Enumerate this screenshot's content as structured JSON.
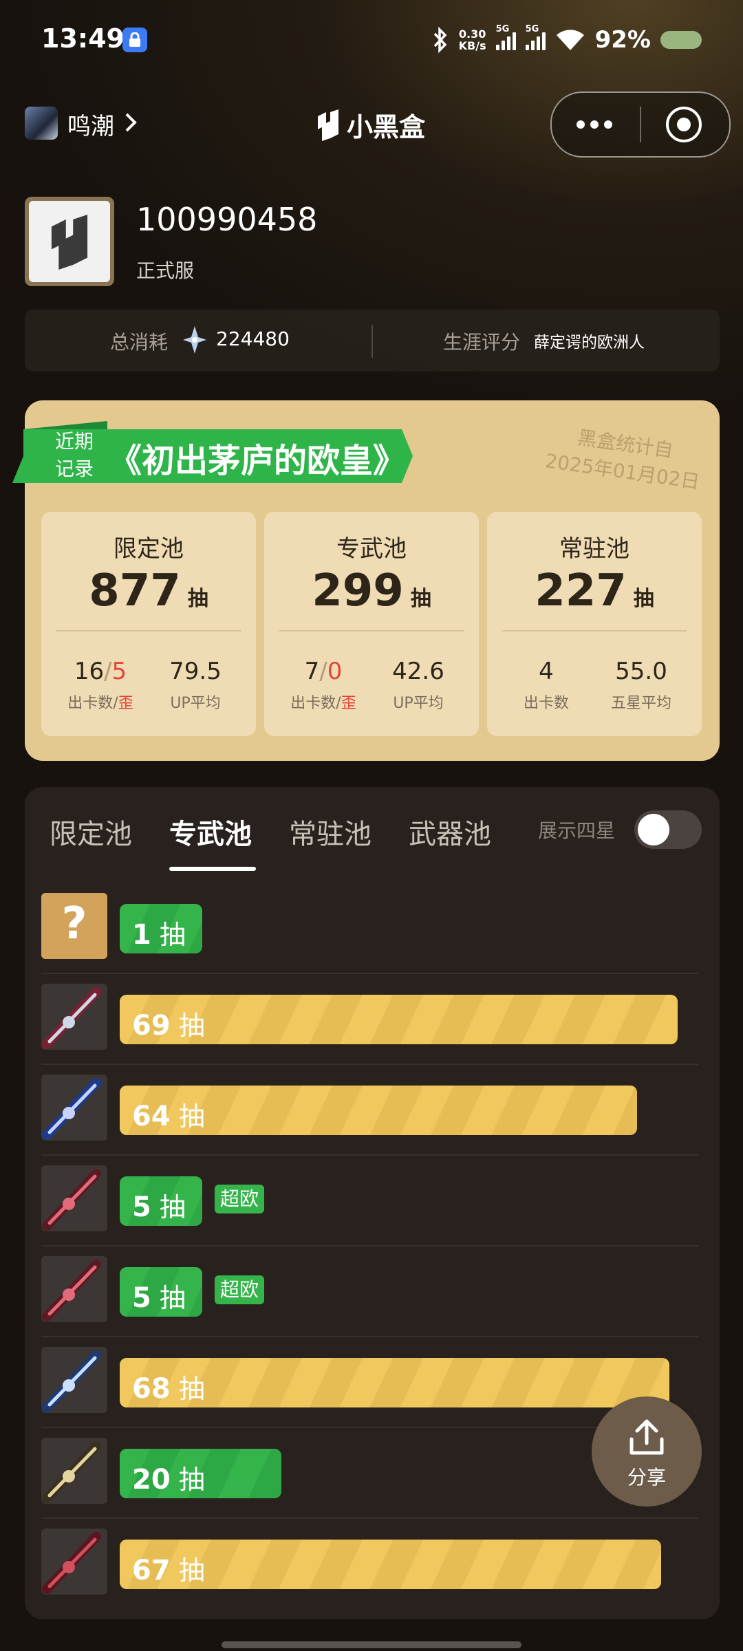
{
  "status_bar": {
    "time": "13:49",
    "net_speed_value": "0.30",
    "net_speed_unit": "KB/s",
    "sim1_label": "5G",
    "sim2_label": "5G",
    "battery": "92%",
    "icons": [
      "lock-icon",
      "bluetooth-icon",
      "signal-icon",
      "wifi-icon",
      "weather-icon"
    ]
  },
  "top_bar": {
    "game_name": "鸣潮",
    "brand_name": "小黑盒"
  },
  "profile": {
    "uid": "100990458",
    "server": "正式服"
  },
  "summary": {
    "total_cost_label": "总消耗",
    "total_cost_value": "224480",
    "career_label": "生涯评分",
    "career_value": "薛定谔的欧洲人"
  },
  "record_card": {
    "tag": "近期记录",
    "tag_line1": "近期",
    "tag_line2": "记录",
    "title": "《初出茅庐的欧皇》",
    "stamp_line1": "黑盒统计自",
    "stamp_line2": "2025年01月02日",
    "pull_unit": "抽",
    "pools": [
      {
        "name": "限定池",
        "pulls": "877",
        "count": "16",
        "off": "5",
        "count_label": "出卡数/",
        "off_label": "歪",
        "avg": "79.5",
        "avg_label": "UP平均"
      },
      {
        "name": "专武池",
        "pulls": "299",
        "count": "7",
        "off": "0",
        "count_label": "出卡数/",
        "off_label": "歪",
        "avg": "42.6",
        "avg_label": "UP平均"
      },
      {
        "name": "常驻池",
        "pulls": "227",
        "count": "4",
        "count_label": "出卡数",
        "avg": "55.0",
        "avg_label": "五星平均"
      }
    ]
  },
  "history": {
    "tabs": [
      "限定池",
      "专武池",
      "常驻池",
      "武器池"
    ],
    "active_tab": "专武池",
    "toggle_label": "展示四星",
    "toggle_on": false,
    "unit": "抽",
    "lucky_badge": "超欧",
    "rows": [
      {
        "pulls": 1,
        "color": "green",
        "unknown": true,
        "badge": false
      },
      {
        "pulls": 69,
        "color": "gold",
        "badge": false
      },
      {
        "pulls": 64,
        "color": "gold",
        "badge": false
      },
      {
        "pulls": 5,
        "color": "green",
        "badge": true
      },
      {
        "pulls": 5,
        "color": "green",
        "badge": true
      },
      {
        "pulls": 68,
        "color": "gold",
        "badge": false
      },
      {
        "pulls": 20,
        "color": "green",
        "badge": false
      },
      {
        "pulls": 67,
        "color": "gold",
        "badge": false
      }
    ]
  },
  "share_button": {
    "label": "分享"
  },
  "colors": {
    "gold_bar": "#f0c85e",
    "green_bar": "#35b44c",
    "card_bg": "#e3c88f",
    "page_bg": "#17120e",
    "accent_red": "#e0453a"
  }
}
